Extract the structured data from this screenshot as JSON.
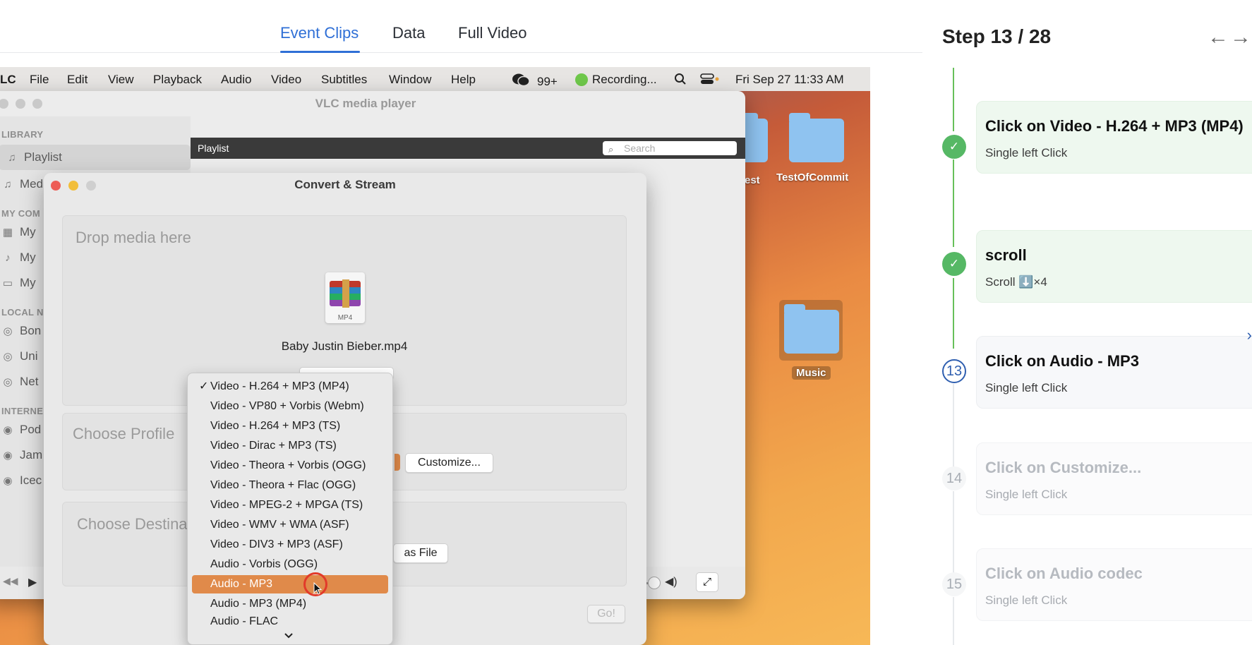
{
  "tabs": [
    {
      "label": "Event Clips",
      "active": true
    },
    {
      "label": "Data",
      "active": false
    },
    {
      "label": "Full Video",
      "active": false
    }
  ],
  "menubar": {
    "app": "LC",
    "items": [
      "File",
      "Edit",
      "View",
      "Playback",
      "Audio",
      "Video",
      "Subtitles",
      "Window",
      "Help"
    ],
    "wechat_badge": "99+",
    "recording": "Recording...",
    "datetime": "Fri Sep 27  11:33 AM"
  },
  "vlc": {
    "title": "VLC media player",
    "sidebar": {
      "library_head": "LIBRARY",
      "playlist": "Playlist",
      "media": "Med",
      "my_computer_head": "MY COM",
      "my_items": [
        "My",
        "My",
        "My"
      ],
      "local_head": "LOCAL N",
      "local_items": [
        "Bon",
        "Uni",
        "Net"
      ],
      "internet_head": "INTERNE",
      "internet_items": [
        "Pod",
        "Jam",
        "Icec"
      ]
    },
    "playlist_label": "Playlist",
    "search_placeholder": "Search"
  },
  "desktop": {
    "test_label": "test",
    "commit_label": "TestOfCommit",
    "music_label": "Music"
  },
  "dialog": {
    "title": "Convert & Stream",
    "drop_title": "Drop media here",
    "file_ext": "MP4",
    "file_name": "Baby Justin Bieber.mp4",
    "choose_profile": "Choose Profile",
    "customize": "Customize...",
    "choose_destination": "Choose Destina",
    "save_as_file": "as File",
    "go": "Go!"
  },
  "dropdown": {
    "selected_check": "✓",
    "items": [
      "Video - H.264 + MP3 (MP4)",
      "Video - VP80 + Vorbis (Webm)",
      "Video - H.264 + MP3 (TS)",
      "Video - Dirac + MP3 (TS)",
      "Video - Theora + Vorbis (OGG)",
      "Video - Theora + Flac (OGG)",
      "Video - MPEG-2 + MPGA (TS)",
      "Video - WMV + WMA (ASF)",
      "Video - DIV3 + MP3 (ASF)",
      "Audio - Vorbis (OGG)",
      "Audio - MP3",
      "Audio - MP3 (MP4)",
      "Audio - FLAC"
    ],
    "highlighted_index": 10
  },
  "steps": {
    "header": "Step 13 / 28",
    "prev_arrow": "←",
    "next_arrow": "→",
    "list": [
      {
        "status": "done",
        "node": "✓",
        "title": "Click on Video - H.264 + MP3 (MP4)",
        "sub": "Single left Click"
      },
      {
        "status": "done",
        "node": "✓",
        "title": "scroll",
        "sub": "Scroll ⬇️×4"
      },
      {
        "status": "current",
        "node": "13",
        "title": "Click on Audio - MP3",
        "sub": "Single left Click"
      },
      {
        "status": "todo",
        "node": "14",
        "title": "Click on Customize...",
        "sub": "Single left Click"
      },
      {
        "status": "todo",
        "node": "15",
        "title": "Click on Audio codec",
        "sub": "Single left Click"
      }
    ]
  },
  "colors": {
    "accent": "#2f6fd6",
    "done": "#56b865",
    "current": "#2f5fb0",
    "menu_highlight": "#e08a4a"
  }
}
